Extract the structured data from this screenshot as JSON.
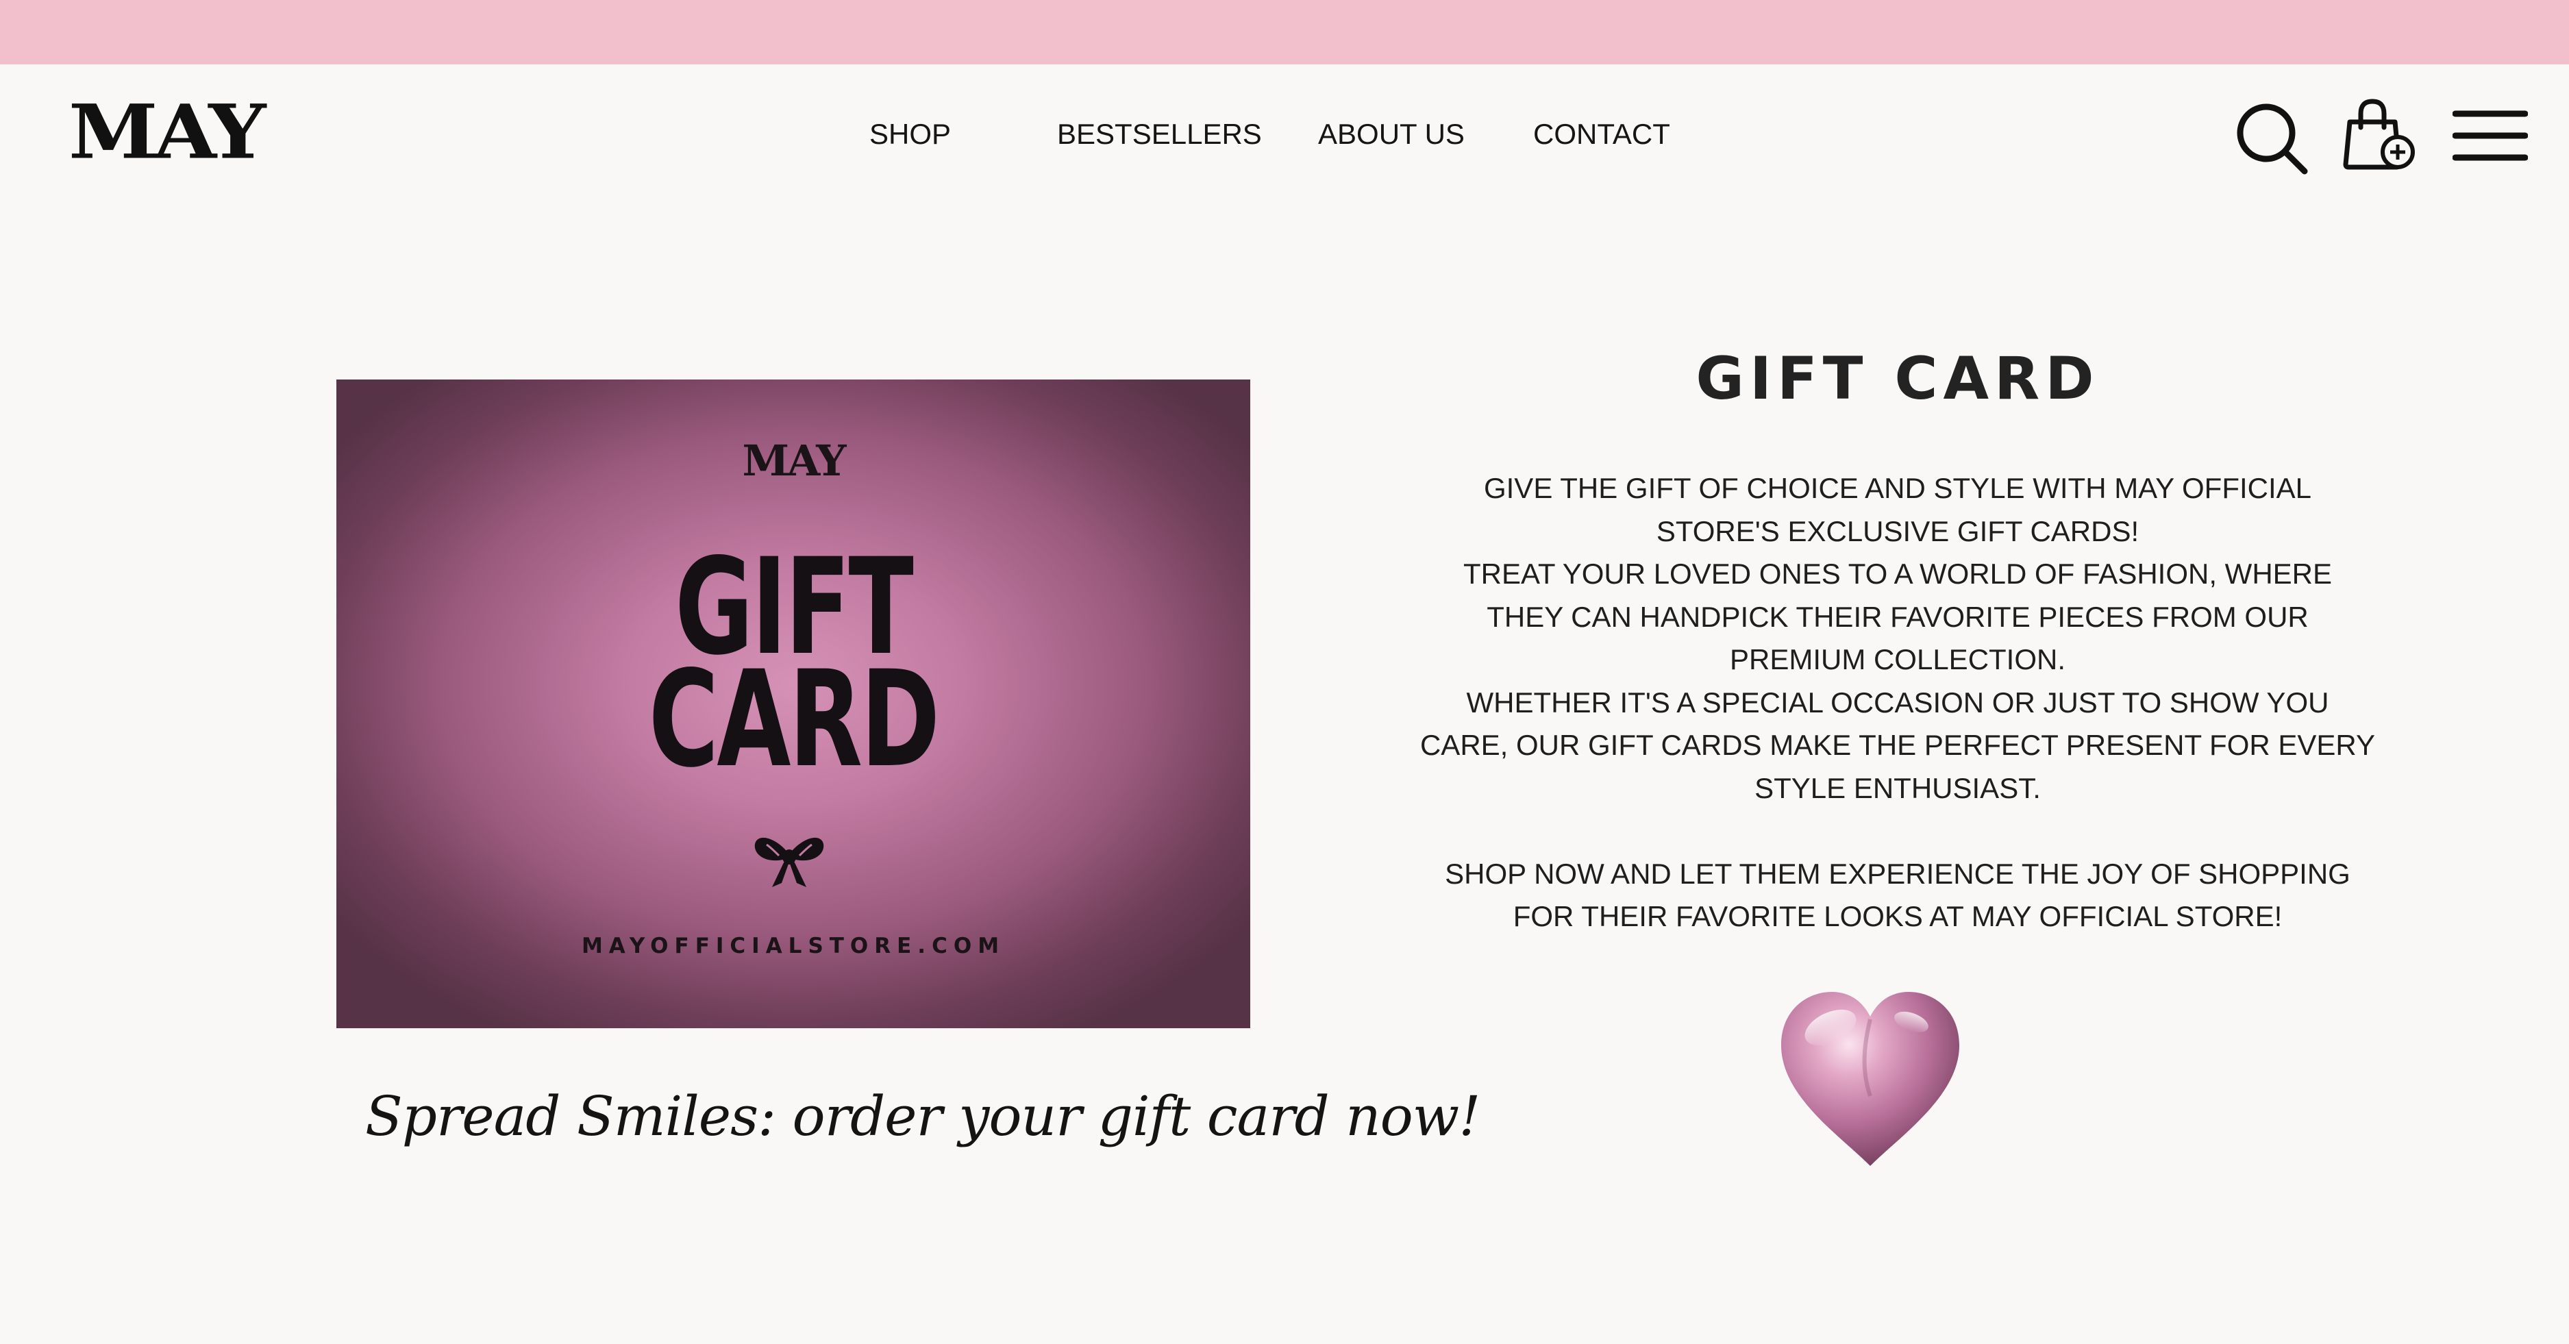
{
  "header": {
    "logo": "MAY",
    "nav": {
      "shop": "SHOP",
      "bestsellers": "BESTSELLERS",
      "about": "ABOUT US",
      "contact": "CONTACT"
    },
    "icons": [
      "search-icon",
      "shopping-bag-add-icon",
      "menu-icon"
    ]
  },
  "gift_card_image": {
    "logo": "MAY",
    "title_line1": "GIFT",
    "title_line2": "CARD",
    "url": "MAYOFFICIALSTORE.COM",
    "icon": "bow-icon"
  },
  "tagline": "Spread Smiles: order your gift card now!",
  "product": {
    "title": "GIFT CARD",
    "desc_lines": [
      "GIVE THE GIFT OF CHOICE AND STYLE WITH MAY OFFICIAL",
      "STORE'S EXCLUSIVE GIFT CARDS!",
      "TREAT YOUR LOVED ONES TO A WORLD OF FASHION, WHERE",
      "THEY CAN HANDPICK THEIR FAVORITE PIECES FROM OUR",
      "PREMIUM COLLECTION.",
      "WHETHER IT'S A SPECIAL OCCASION OR JUST TO SHOW YOU",
      "CARE, OUR GIFT CARDS MAKE THE PERFECT PRESENT FOR EVERY",
      "STYLE ENTHUSIAST."
    ],
    "cta_lines": [
      "SHOP NOW AND LET THEM EXPERIENCE THE JOY OF SHOPPING",
      "FOR THEIR FAVORITE LOOKS AT MAY OFFICIAL STORE!"
    ],
    "decoration": "heart-icon"
  },
  "colors": {
    "promo_bar": "#f2c0cc",
    "background": "#f9f8f6",
    "card_center": "#d692b6",
    "card_edge": "#573347",
    "text": "#1c1c1c"
  }
}
